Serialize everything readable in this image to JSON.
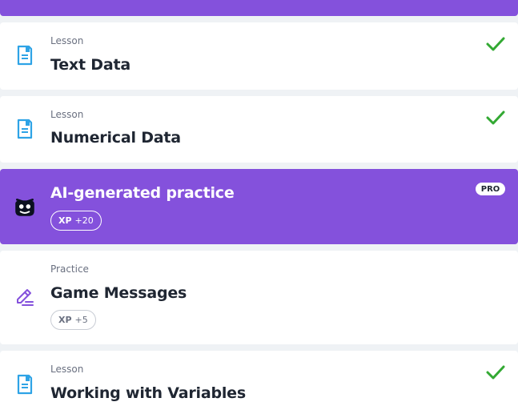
{
  "items": [
    {
      "kicker": "Lesson",
      "title": "Text Data",
      "icon": "lesson-document-icon",
      "completed": true
    },
    {
      "kicker": "Lesson",
      "title": "Numerical Data",
      "icon": "lesson-document-icon",
      "completed": true
    },
    {
      "kicker": "",
      "title": "AI-generated practice",
      "icon": "ai-bot-face-icon",
      "badge": "PRO",
      "xp_label": "XP",
      "xp_value": "+20"
    },
    {
      "kicker": "Practice",
      "title": "Game Messages",
      "icon": "pencil-edit-icon",
      "xp_label": "XP",
      "xp_value": "+5"
    },
    {
      "kicker": "Lesson",
      "title": "Working with Variables",
      "icon": "lesson-document-icon",
      "completed": true
    }
  ],
  "colors": {
    "accent_purple": "#8451dc",
    "check_green": "#33a933",
    "lesson_icon_blue": "#2ea3e6",
    "background": "#eff2f5"
  }
}
